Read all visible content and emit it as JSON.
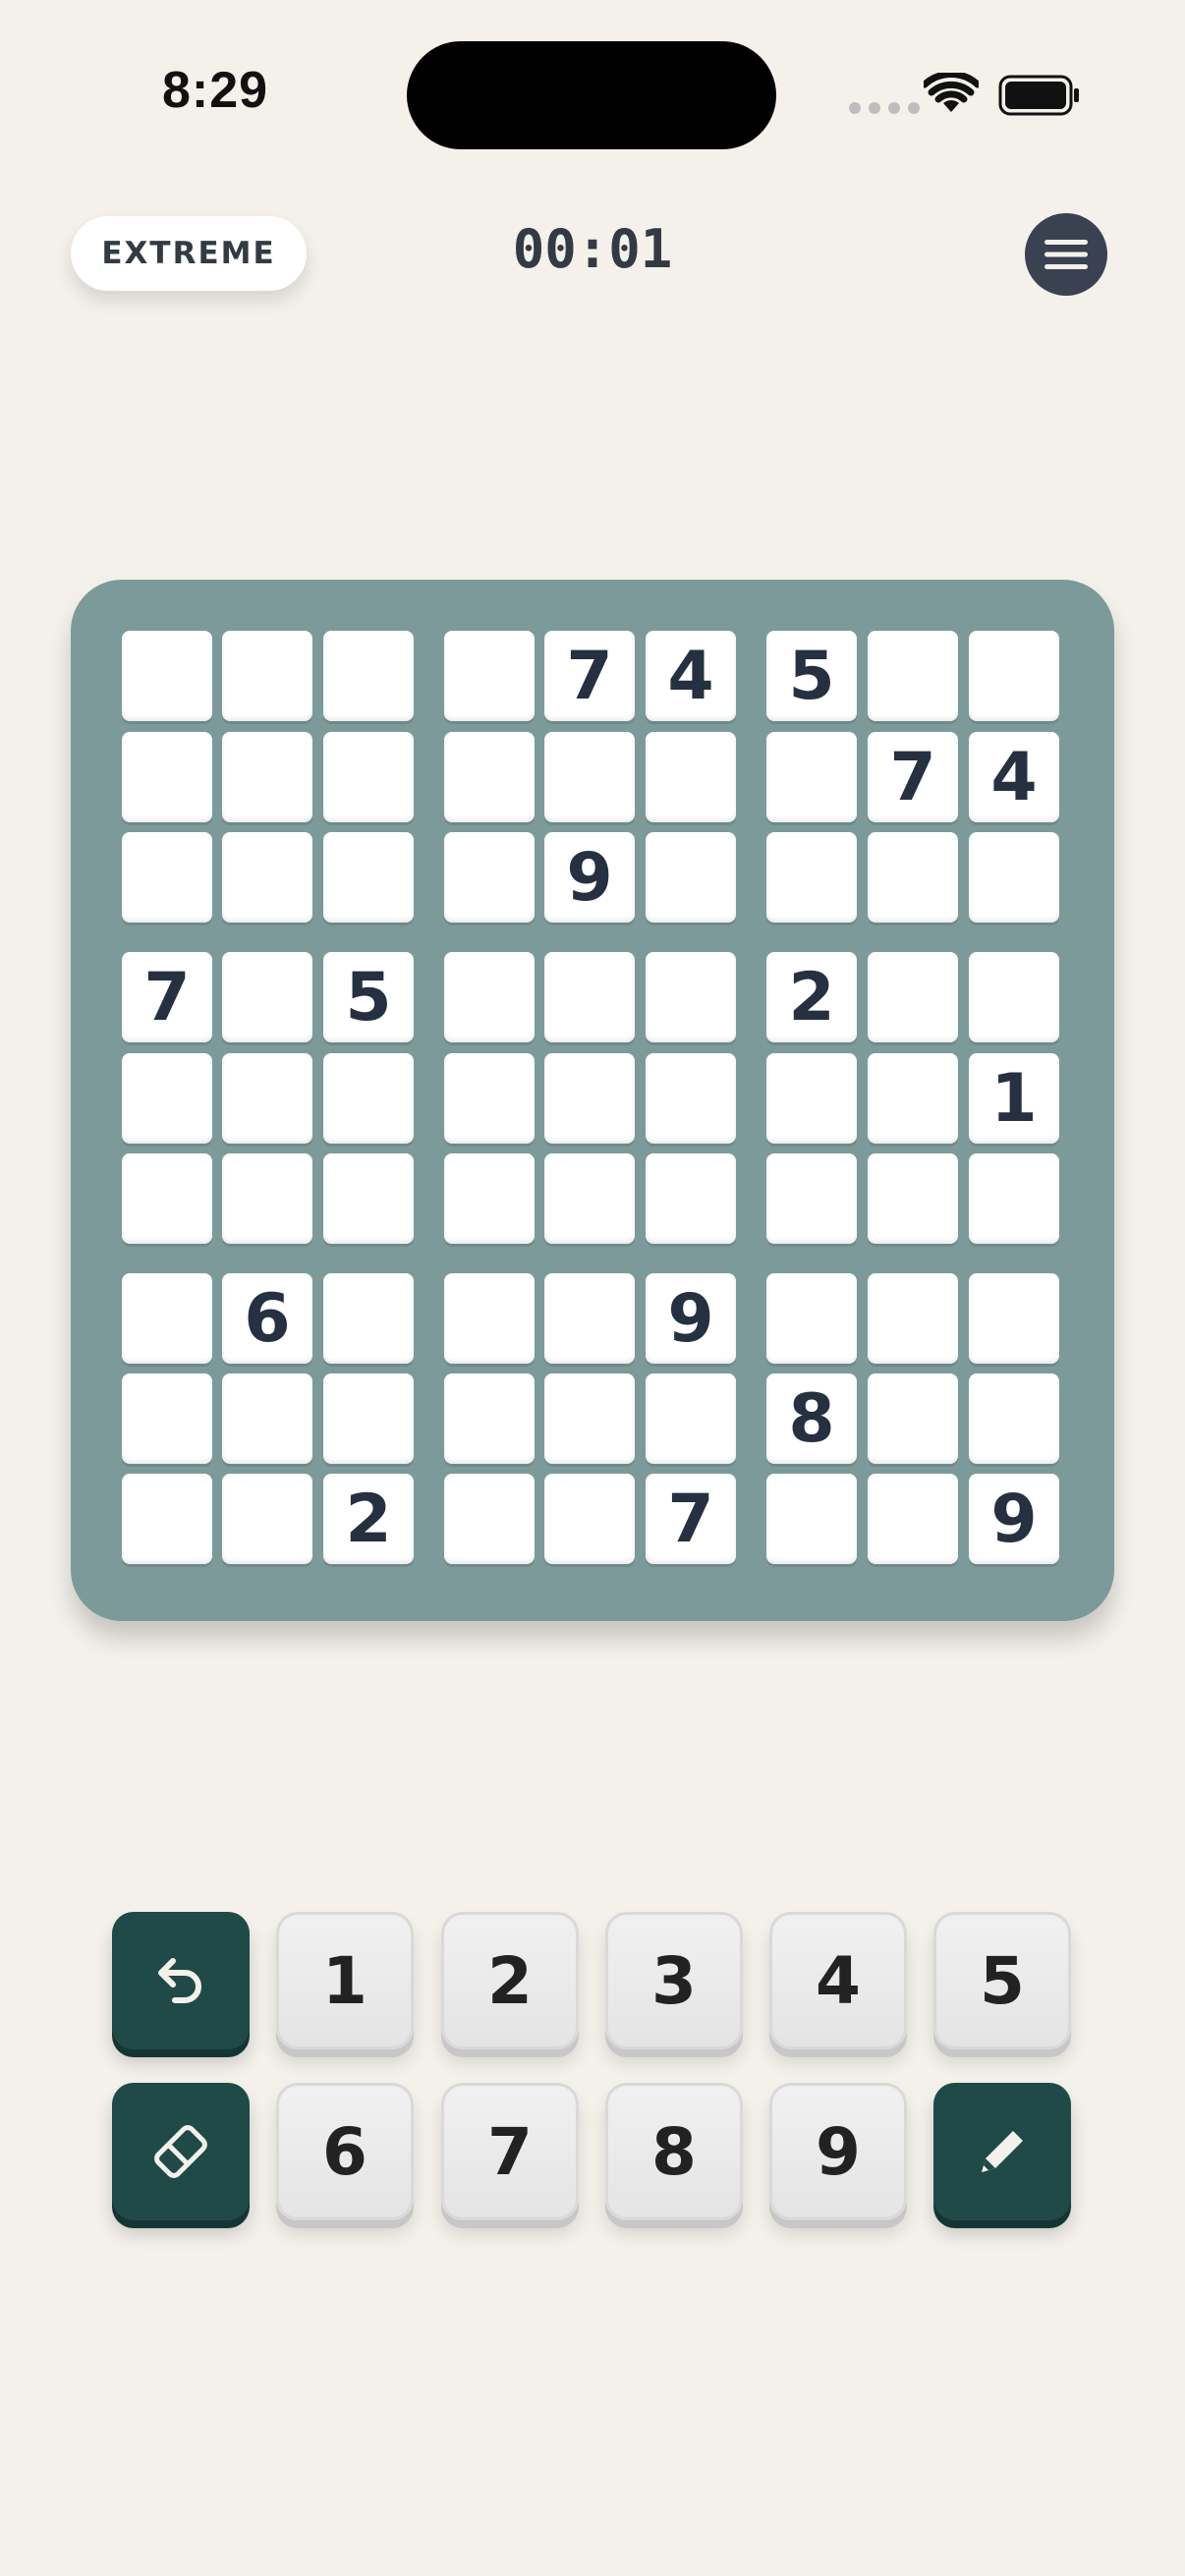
{
  "status_bar": {
    "time": "8:29"
  },
  "header": {
    "difficulty": "EXTREME",
    "timer": "00:01",
    "menu_icon": "hamburger-icon"
  },
  "board": {
    "rows": [
      [
        "",
        "",
        "",
        "",
        "7",
        "4",
        "5",
        "",
        ""
      ],
      [
        "",
        "",
        "",
        "",
        "",
        "",
        "",
        "7",
        "4"
      ],
      [
        "",
        "",
        "",
        "",
        "9",
        "",
        "",
        "",
        ""
      ],
      [
        "7",
        "",
        "5",
        "",
        "",
        "",
        "2",
        "",
        ""
      ],
      [
        "",
        "",
        "",
        "",
        "",
        "",
        "",
        "",
        "1"
      ],
      [
        "",
        "",
        "",
        "",
        "",
        "",
        "",
        "",
        ""
      ],
      [
        "",
        "6",
        "",
        "",
        "",
        "9",
        "",
        "",
        ""
      ],
      [
        "",
        "",
        "",
        "",
        "",
        "",
        "8",
        "",
        ""
      ],
      [
        "",
        "",
        "2",
        "",
        "",
        "7",
        "",
        "",
        "9"
      ]
    ]
  },
  "keypad": {
    "row1": [
      {
        "type": "action",
        "icon": "undo-icon",
        "label": ""
      },
      {
        "type": "number",
        "label": "1"
      },
      {
        "type": "number",
        "label": "2"
      },
      {
        "type": "number",
        "label": "3"
      },
      {
        "type": "number",
        "label": "4"
      },
      {
        "type": "number",
        "label": "5"
      }
    ],
    "row2": [
      {
        "type": "action",
        "icon": "eraser-icon",
        "label": ""
      },
      {
        "type": "number",
        "label": "6"
      },
      {
        "type": "number",
        "label": "7"
      },
      {
        "type": "number",
        "label": "8"
      },
      {
        "type": "number",
        "label": "9"
      },
      {
        "type": "action",
        "icon": "pencil-icon",
        "label": ""
      }
    ]
  },
  "colors": {
    "background": "#f4f1eb",
    "board": "#7d9a9a",
    "digit": "#253041",
    "action_key": "#1f4a48"
  }
}
